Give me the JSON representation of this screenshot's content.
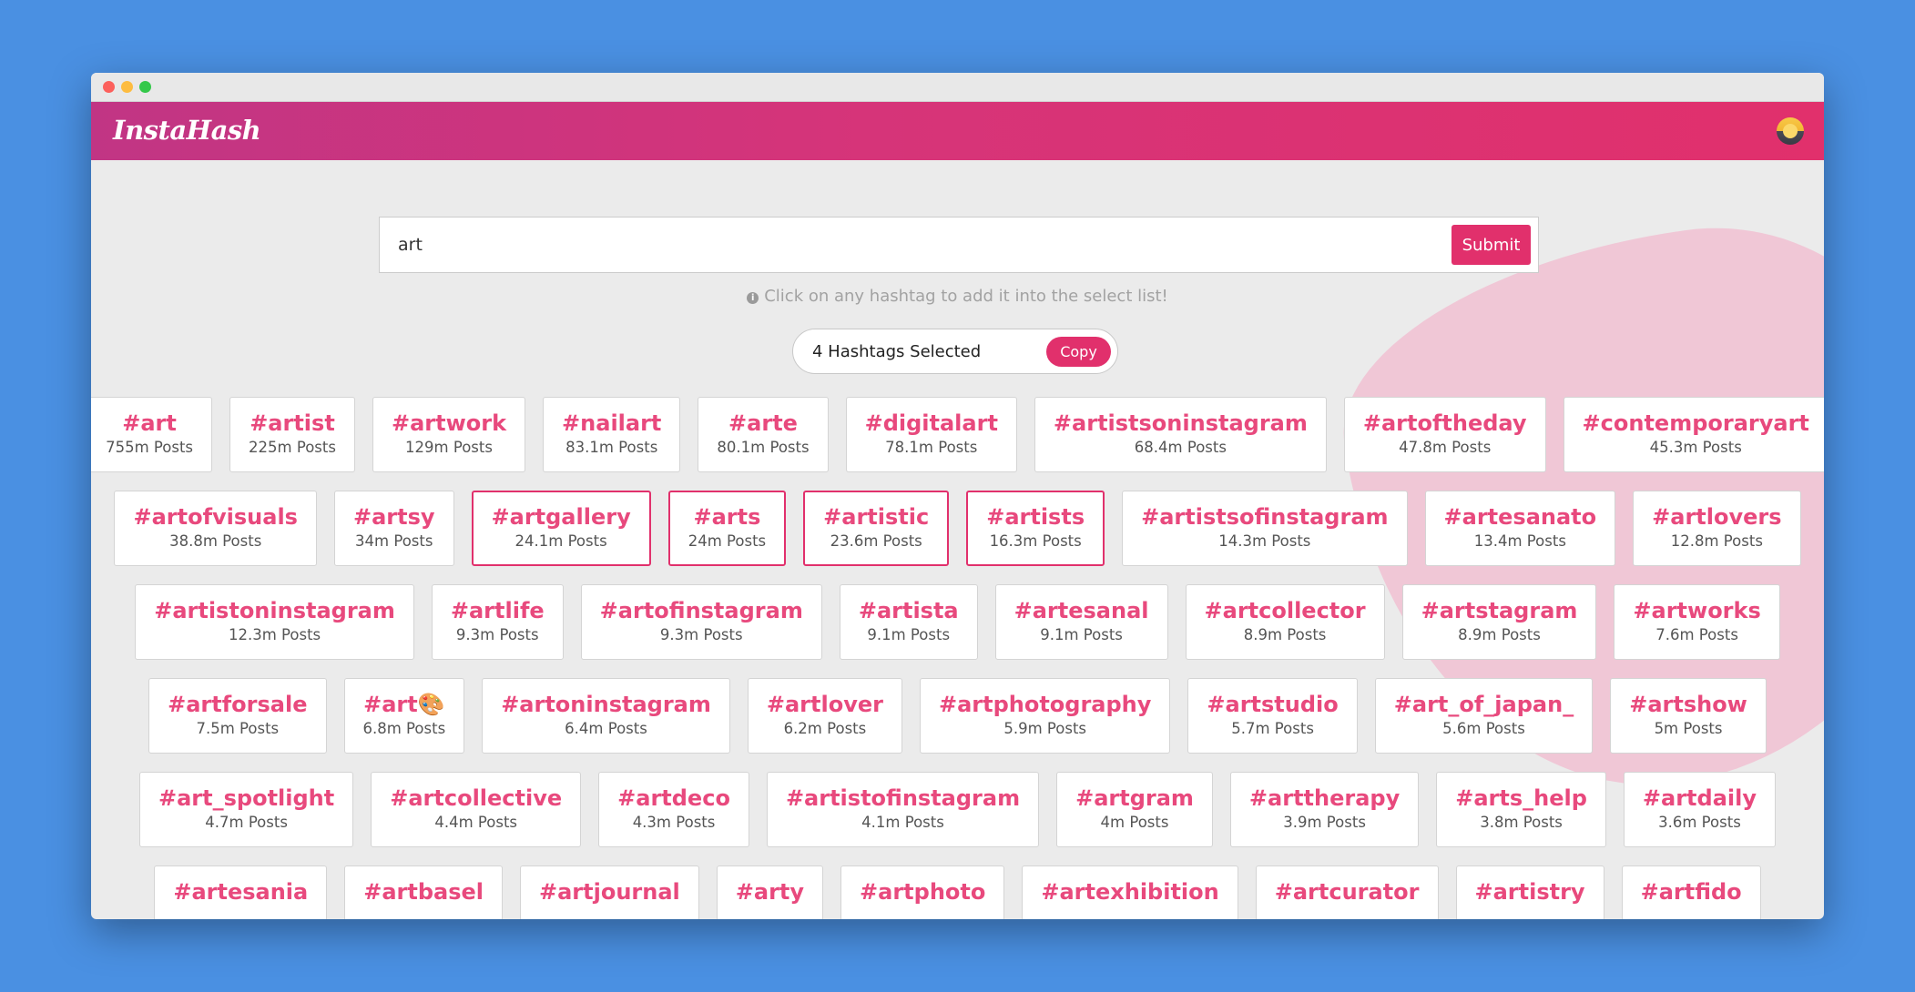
{
  "window": {
    "app_name": "InstaHash",
    "search": {
      "value": "art",
      "submit_label": "Submit"
    },
    "hint": "Click on any hashtag to add it into the select list!",
    "selection": {
      "count_label": "4 Hashtags Selected",
      "copy_label": "Copy"
    }
  },
  "colors": {
    "accent": "#e1306c",
    "header_start": "#c13584",
    "header_end": "#e1306c",
    "tag_text": "#e8497d",
    "blob": "#f0c7d6"
  },
  "hashtag_rows": [
    [
      {
        "tag": "#art",
        "posts": "755m Posts",
        "selected": false
      },
      {
        "tag": "#artist",
        "posts": "225m Posts",
        "selected": false
      },
      {
        "tag": "#artwork",
        "posts": "129m Posts",
        "selected": false
      },
      {
        "tag": "#nailart",
        "posts": "83.1m Posts",
        "selected": false
      },
      {
        "tag": "#arte",
        "posts": "80.1m Posts",
        "selected": false
      },
      {
        "tag": "#digitalart",
        "posts": "78.1m Posts",
        "selected": false
      },
      {
        "tag": "#artistsoninstagram",
        "posts": "68.4m Posts",
        "selected": false
      },
      {
        "tag": "#artoftheday",
        "posts": "47.8m Posts",
        "selected": false
      },
      {
        "tag": "#contemporaryart",
        "posts": "45.3m Posts",
        "selected": false
      }
    ],
    [
      {
        "tag": "#artofvisuals",
        "posts": "38.8m Posts",
        "selected": false
      },
      {
        "tag": "#artsy",
        "posts": "34m Posts",
        "selected": false
      },
      {
        "tag": "#artgallery",
        "posts": "24.1m Posts",
        "selected": true
      },
      {
        "tag": "#arts",
        "posts": "24m Posts",
        "selected": true
      },
      {
        "tag": "#artistic",
        "posts": "23.6m Posts",
        "selected": true
      },
      {
        "tag": "#artists",
        "posts": "16.3m Posts",
        "selected": true
      },
      {
        "tag": "#artistsofinstagram",
        "posts": "14.3m Posts",
        "selected": false
      },
      {
        "tag": "#artesanato",
        "posts": "13.4m Posts",
        "selected": false
      },
      {
        "tag": "#artlovers",
        "posts": "12.8m Posts",
        "selected": false
      }
    ],
    [
      {
        "tag": "#artistoninstagram",
        "posts": "12.3m Posts",
        "selected": false
      },
      {
        "tag": "#artlife",
        "posts": "9.3m Posts",
        "selected": false
      },
      {
        "tag": "#artofinstagram",
        "posts": "9.3m Posts",
        "selected": false
      },
      {
        "tag": "#artista",
        "posts": "9.1m Posts",
        "selected": false
      },
      {
        "tag": "#artesanal",
        "posts": "9.1m Posts",
        "selected": false
      },
      {
        "tag": "#artcollector",
        "posts": "8.9m Posts",
        "selected": false
      },
      {
        "tag": "#artstagram",
        "posts": "8.9m Posts",
        "selected": false
      },
      {
        "tag": "#artworks",
        "posts": "7.6m Posts",
        "selected": false
      }
    ],
    [
      {
        "tag": "#artforsale",
        "posts": "7.5m Posts",
        "selected": false
      },
      {
        "tag": "#art🎨",
        "posts": "6.8m Posts",
        "selected": false
      },
      {
        "tag": "#artoninstagram",
        "posts": "6.4m Posts",
        "selected": false
      },
      {
        "tag": "#artlover",
        "posts": "6.2m Posts",
        "selected": false
      },
      {
        "tag": "#artphotography",
        "posts": "5.9m Posts",
        "selected": false
      },
      {
        "tag": "#artstudio",
        "posts": "5.7m Posts",
        "selected": false
      },
      {
        "tag": "#art_of_japan_",
        "posts": "5.6m Posts",
        "selected": false
      },
      {
        "tag": "#artshow",
        "posts": "5m Posts",
        "selected": false
      }
    ],
    [
      {
        "tag": "#art_spotlight",
        "posts": "4.7m Posts",
        "selected": false
      },
      {
        "tag": "#artcollective",
        "posts": "4.4m Posts",
        "selected": false
      },
      {
        "tag": "#artdeco",
        "posts": "4.3m Posts",
        "selected": false
      },
      {
        "tag": "#artistofinstagram",
        "posts": "4.1m Posts",
        "selected": false
      },
      {
        "tag": "#artgram",
        "posts": "4m Posts",
        "selected": false
      },
      {
        "tag": "#arttherapy",
        "posts": "3.9m Posts",
        "selected": false
      },
      {
        "tag": "#arts_help",
        "posts": "3.8m Posts",
        "selected": false
      },
      {
        "tag": "#artdaily",
        "posts": "3.6m Posts",
        "selected": false
      }
    ],
    [
      {
        "tag": "#artesania",
        "posts": "",
        "selected": false
      },
      {
        "tag": "#artbasel",
        "posts": "",
        "selected": false
      },
      {
        "tag": "#artjournal",
        "posts": "",
        "selected": false
      },
      {
        "tag": "#arty",
        "posts": "",
        "selected": false
      },
      {
        "tag": "#artphoto",
        "posts": "",
        "selected": false
      },
      {
        "tag": "#artexhibition",
        "posts": "",
        "selected": false
      },
      {
        "tag": "#artcurator",
        "posts": "",
        "selected": false
      },
      {
        "tag": "#artistry",
        "posts": "",
        "selected": false
      },
      {
        "tag": "#artfido",
        "posts": "",
        "selected": false
      }
    ]
  ]
}
